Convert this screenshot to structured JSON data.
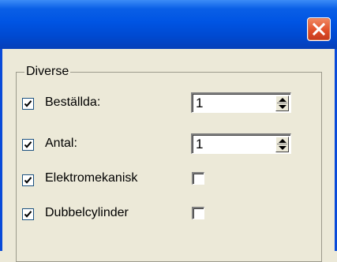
{
  "window": {
    "close_icon": "close-x-icon",
    "titlebar_color": "#0054e3",
    "close_color": "#e1502a"
  },
  "group": {
    "legend": "Diverse",
    "rows": [
      {
        "label": "Beställda:",
        "checked": true,
        "control": "spinner",
        "value": "1"
      },
      {
        "label": "Antal:",
        "checked": true,
        "control": "spinner",
        "value": "1"
      },
      {
        "label": "Elektromekanisk",
        "checked": true,
        "control": "checkbox",
        "value_checked": false
      },
      {
        "label": "Dubbelcylinder",
        "checked": true,
        "control": "checkbox",
        "value_checked": false
      }
    ]
  }
}
